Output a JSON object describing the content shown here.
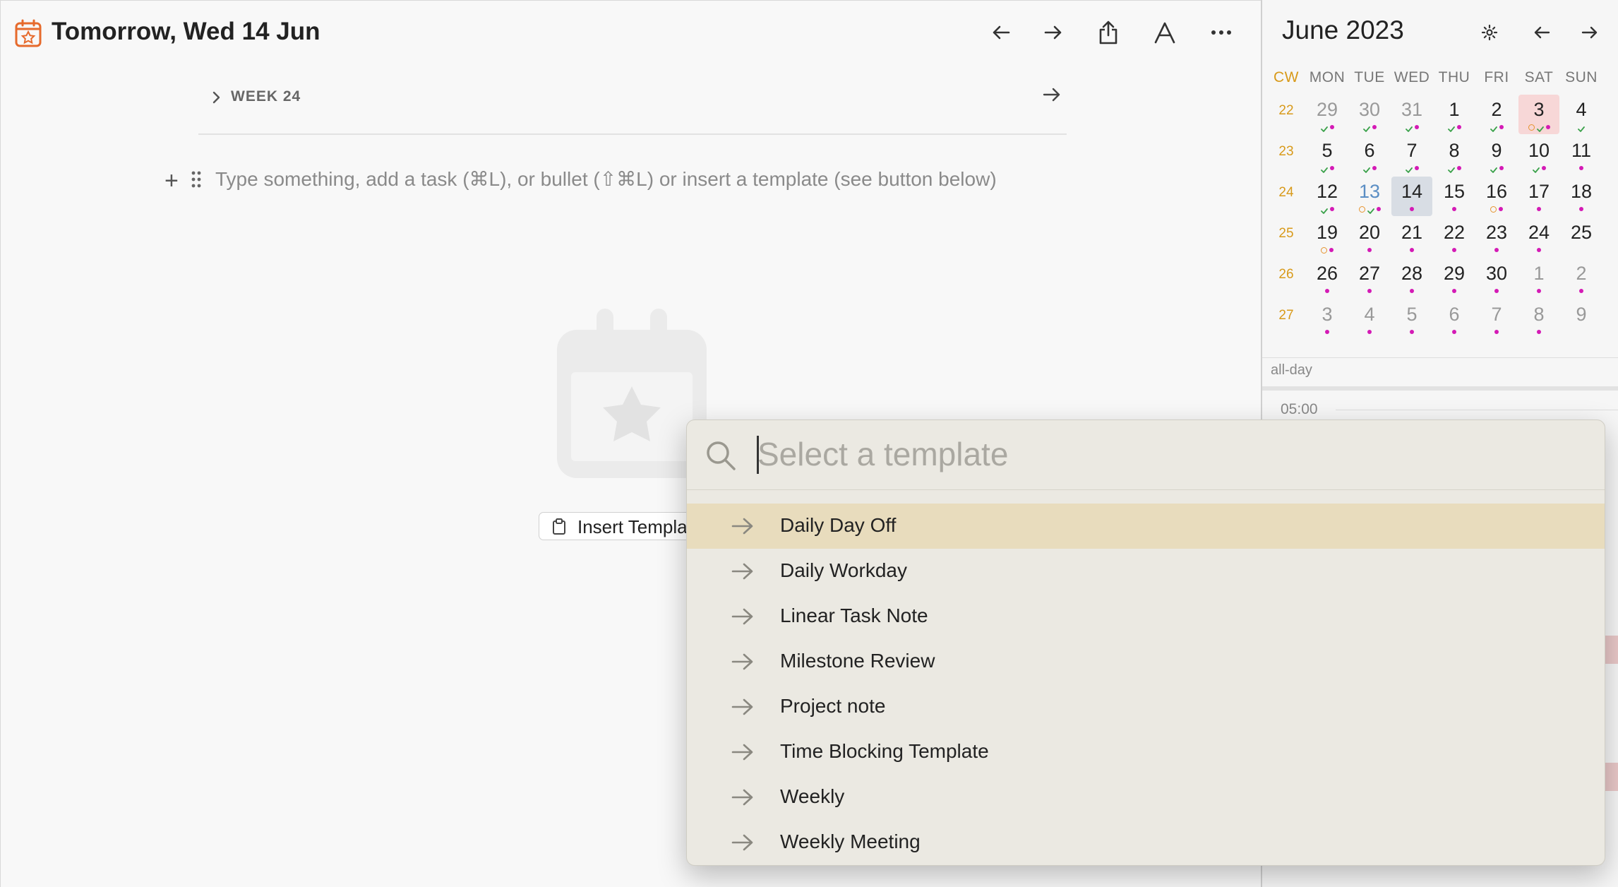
{
  "header": {
    "title": "Tomorrow, Wed 14 Jun",
    "icons": [
      "calendar-star-icon",
      "arrow-left-icon",
      "arrow-right-icon",
      "share-icon",
      "font-icon",
      "more-icon"
    ]
  },
  "editor": {
    "week_label": "WEEK 24",
    "placeholder": "Type something, add a task (⌘L), or bullet (⇧⌘L) or insert a template (see button below)",
    "insert_template_label": "Insert Templa"
  },
  "sidebar": {
    "month_title": "June 2023",
    "dow": [
      "CW",
      "MON",
      "TUE",
      "WED",
      "THU",
      "FRI",
      "SAT",
      "SUN"
    ],
    "weeks": [
      {
        "cw": "22",
        "days": [
          {
            "d": "29",
            "muted": true,
            "marks": [
              "check",
              "dot"
            ]
          },
          {
            "d": "30",
            "muted": true,
            "marks": [
              "check",
              "dot"
            ]
          },
          {
            "d": "31",
            "muted": true,
            "marks": [
              "check",
              "dot"
            ]
          },
          {
            "d": "1",
            "marks": [
              "check",
              "dot"
            ]
          },
          {
            "d": "2",
            "marks": [
              "check",
              "dot"
            ]
          },
          {
            "d": "3",
            "sel": true,
            "marks": [
              "circ",
              "check",
              "dot"
            ]
          },
          {
            "d": "4",
            "marks": [
              "check"
            ]
          }
        ]
      },
      {
        "cw": "23",
        "days": [
          {
            "d": "5",
            "marks": [
              "check",
              "dot"
            ]
          },
          {
            "d": "6",
            "marks": [
              "check",
              "dot"
            ]
          },
          {
            "d": "7",
            "marks": [
              "check",
              "dot"
            ]
          },
          {
            "d": "8",
            "marks": [
              "check",
              "dot"
            ]
          },
          {
            "d": "9",
            "marks": [
              "check",
              "dot"
            ]
          },
          {
            "d": "10",
            "marks": [
              "check",
              "dot"
            ]
          },
          {
            "d": "11",
            "marks": [
              "dot"
            ]
          }
        ]
      },
      {
        "cw": "24",
        "days": [
          {
            "d": "12",
            "marks": [
              "check",
              "dot"
            ]
          },
          {
            "d": "13",
            "blue": true,
            "marks": [
              "circ",
              "check",
              "dot"
            ]
          },
          {
            "d": "14",
            "today": true,
            "marks": [
              "dot"
            ]
          },
          {
            "d": "15",
            "marks": [
              "dot"
            ]
          },
          {
            "d": "16",
            "marks": [
              "circ",
              "dot"
            ]
          },
          {
            "d": "17",
            "marks": [
              "dot"
            ]
          },
          {
            "d": "18",
            "marks": [
              "dot"
            ]
          }
        ]
      },
      {
        "cw": "25",
        "days": [
          {
            "d": "19",
            "marks": [
              "circ",
              "dot"
            ]
          },
          {
            "d": "20",
            "marks": [
              "dot"
            ]
          },
          {
            "d": "21",
            "marks": [
              "dot"
            ]
          },
          {
            "d": "22",
            "marks": [
              "dot"
            ]
          },
          {
            "d": "23",
            "marks": [
              "dot"
            ]
          },
          {
            "d": "24",
            "marks": [
              "dot"
            ]
          },
          {
            "d": "25",
            "marks": []
          }
        ]
      },
      {
        "cw": "26",
        "days": [
          {
            "d": "26",
            "marks": [
              "dot"
            ]
          },
          {
            "d": "27",
            "marks": [
              "dot"
            ]
          },
          {
            "d": "28",
            "marks": [
              "dot"
            ]
          },
          {
            "d": "29",
            "marks": [
              "dot"
            ]
          },
          {
            "d": "30",
            "marks": [
              "dot"
            ]
          },
          {
            "d": "1",
            "muted": true,
            "marks": [
              "dot"
            ]
          },
          {
            "d": "2",
            "muted": true,
            "marks": [
              "dot"
            ]
          }
        ]
      },
      {
        "cw": "27",
        "days": [
          {
            "d": "3",
            "muted": true,
            "marks": [
              "dot"
            ]
          },
          {
            "d": "4",
            "muted": true,
            "marks": [
              "dot"
            ]
          },
          {
            "d": "5",
            "muted": true,
            "marks": [
              "dot"
            ]
          },
          {
            "d": "6",
            "muted": true,
            "marks": [
              "dot"
            ]
          },
          {
            "d": "7",
            "muted": true,
            "marks": [
              "dot"
            ]
          },
          {
            "d": "8",
            "muted": true,
            "marks": [
              "dot"
            ]
          },
          {
            "d": "9",
            "muted": true,
            "marks": []
          }
        ]
      }
    ],
    "allday_label": "all-day",
    "time_label": "05:00"
  },
  "template_picker": {
    "placeholder": "Select a template",
    "items": [
      {
        "label": "Daily Day Off",
        "active": true
      },
      {
        "label": "Daily Workday"
      },
      {
        "label": "Linear Task Note"
      },
      {
        "label": "Milestone Review"
      },
      {
        "label": "Project note"
      },
      {
        "label": "Time Blocking Template"
      },
      {
        "label": "Weekly"
      },
      {
        "label": "Weekly Meeting"
      }
    ]
  },
  "colors": {
    "accent_orange": "#e6932e",
    "event_dot": "#d41ab5",
    "check_green": "#3aa14a",
    "picker_highlight": "#e8dcbd"
  }
}
